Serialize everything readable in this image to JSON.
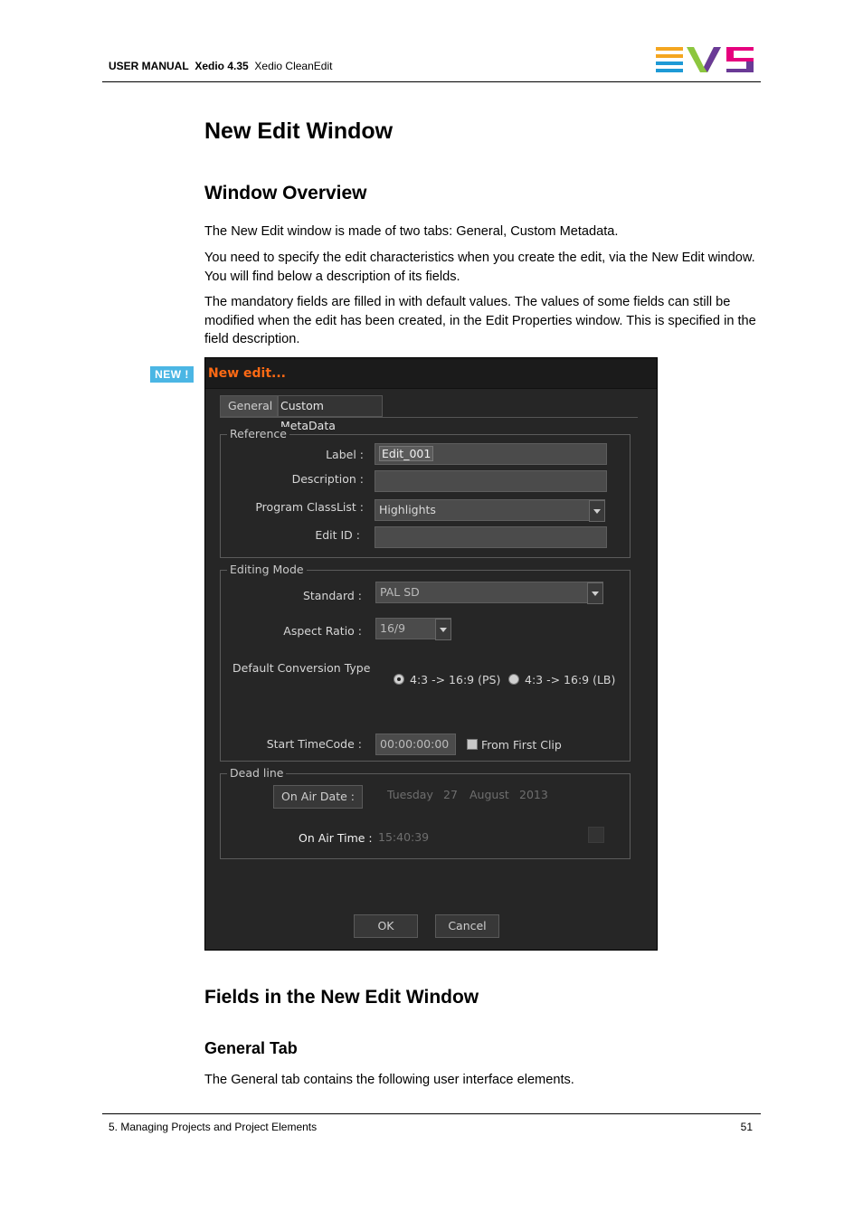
{
  "header": {
    "manual": "USER MANUAL",
    "product": "Xedio 4.35",
    "module": "Xedio CleanEdit",
    "logo": "evs-logo",
    "logo_colors": [
      "#f4a620",
      "#1e9ad6",
      "#8cc63f",
      "#6a3a96",
      "#e6007e"
    ]
  },
  "title": "New Edit Window",
  "section1": {
    "heading": "Window Overview",
    "p1": "The New Edit window is made of two tabs: General, Custom Metadata.",
    "p2": "You need to specify the edit characteristics when you create the edit, via the New Edit window. You will find below a description of its fields.",
    "p3": "The mandatory fields are filled in with default values. The values of some fields can still be modified when the edit has been created, in the Edit Properties window. This is specified in the field description."
  },
  "badge": "NEW !",
  "dialog": {
    "title": "New edit...",
    "tabs": [
      "General",
      "Custom MetaData"
    ],
    "reference": {
      "group_title": "Reference",
      "label_label": "Label :",
      "label_value": "Edit_001",
      "description_label": "Description :",
      "description_value": "",
      "program_label": "Program ClassList :",
      "program_value": "Highlights",
      "editid_label": "Edit ID :",
      "editid_value": ""
    },
    "editing_mode": {
      "group_title": "Editing Mode",
      "standard_label": "Standard :",
      "standard_value": "PAL SD",
      "aspect_label": "Aspect Ratio :",
      "aspect_value": "16/9",
      "conversion_label": "Default Conversion Type",
      "option_ps": "4:3 -> 16:9 (PS)",
      "option_lb": "4:3 -> 16:9 (LB)",
      "selected_option": "4:3 -> 16:9 (PS)",
      "timecode_label": "Start TimeCode :",
      "timecode_value": "00:00:00:00",
      "from_first_clip": "From First Clip"
    },
    "deadline": {
      "group_title": "Dead line",
      "on_air_date_button": "On Air Date :",
      "day_name": "Tuesday",
      "day": "27",
      "month": "August",
      "year": "2013",
      "on_air_time_label": "On Air Time :",
      "on_air_time_value": "15:40:39"
    },
    "ok": "OK",
    "cancel": "Cancel"
  },
  "section2": {
    "heading": "Fields in the New Edit Window"
  },
  "section3": {
    "heading": "General Tab",
    "p1": "The General tab contains the following user interface elements."
  },
  "footer": {
    "chapter": "5. Managing Projects and Project Elements",
    "page": "51"
  }
}
